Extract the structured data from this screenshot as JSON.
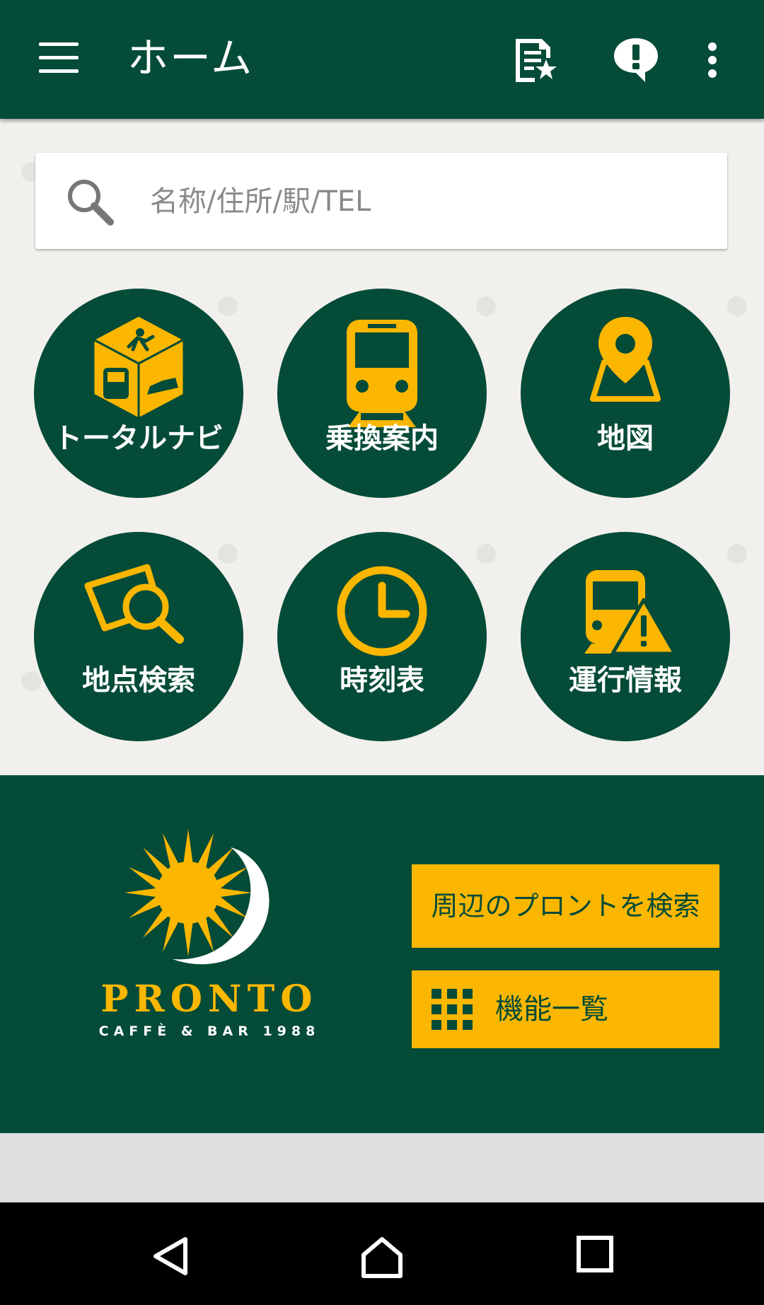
{
  "appbar": {
    "title": "ホーム",
    "icons": [
      "menu-icon",
      "bookmark-star-icon",
      "feedback-icon",
      "overflow-menu-icon"
    ]
  },
  "search": {
    "placeholder": "名称/住所/駅/TEL",
    "value": ""
  },
  "tiles": [
    {
      "label": "トータルナビ",
      "icon": "total-navi-cube-icon"
    },
    {
      "label": "乗換案内",
      "icon": "train-icon"
    },
    {
      "label": "地図",
      "icon": "map-pin-icon"
    },
    {
      "label": "地点検索",
      "icon": "place-search-icon"
    },
    {
      "label": "時刻表",
      "icon": "clock-icon"
    },
    {
      "label": "運行情報",
      "icon": "train-alert-icon"
    }
  ],
  "footer": {
    "logo_text": "PRONTO",
    "logo_sub": "CAFFÈ & BAR 1988",
    "nearby_button": "周辺のプロントを検索",
    "features_button": "機能一覧"
  },
  "colors": {
    "primary": "#044b38",
    "accent": "#fbb700",
    "background": "#f2f0ec"
  },
  "system_nav": [
    "back-icon",
    "home-icon",
    "recents-icon"
  ]
}
